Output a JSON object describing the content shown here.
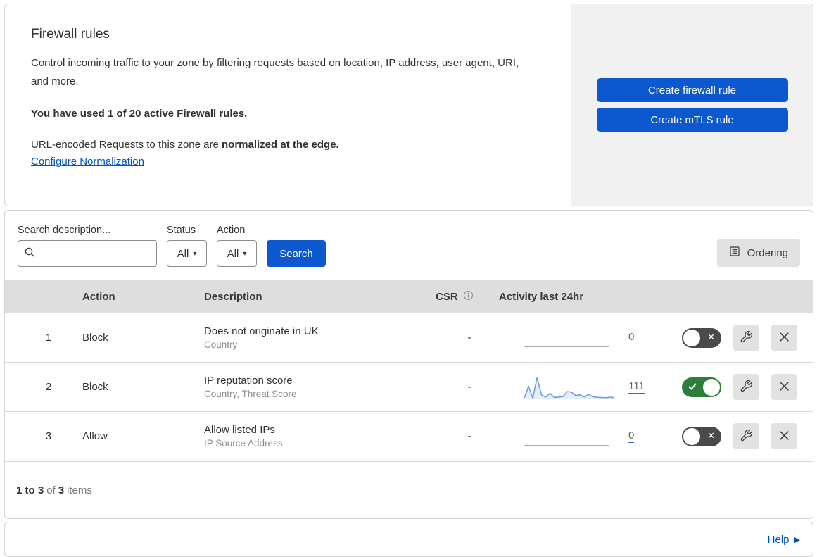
{
  "header": {
    "title": "Firewall rules",
    "description": "Control incoming traffic to your zone by filtering requests based on location, IP address, user agent, URI, and more.",
    "usage_notice": "You have used 1 of 20 active Firewall rules.",
    "normalization_prefix": "URL-encoded Requests to this zone are ",
    "normalization_bold": "normalized at the edge.",
    "normalization_link": "Configure Normalization",
    "create_firewall_button": "Create firewall rule",
    "create_mtls_button": "Create mTLS rule"
  },
  "filters": {
    "search_label": "Search description...",
    "search_value": "",
    "status_label": "Status",
    "status_value": "All",
    "action_label": "Action",
    "action_value": "All",
    "search_button": "Search",
    "ordering_button": "Ordering"
  },
  "table": {
    "columns": {
      "action": "Action",
      "description": "Description",
      "csr": "CSR",
      "activity": "Activity last 24hr"
    },
    "rows": [
      {
        "priority": "1",
        "action": "Block",
        "description": "Does not originate in UK",
        "criteria": "Country",
        "csr": "-",
        "activity_count": "0",
        "enabled": false,
        "sparkline": []
      },
      {
        "priority": "2",
        "action": "Block",
        "description": "IP reputation score",
        "criteria": "Country, Threat Score",
        "csr": "-",
        "activity_count": "111",
        "enabled": true,
        "sparkline": [
          3,
          56,
          2,
          97,
          17,
          7,
          24,
          5,
          7,
          9,
          32,
          30,
          13,
          18,
          7,
          19,
          8,
          6,
          5,
          4,
          6,
          4
        ]
      },
      {
        "priority": "3",
        "action": "Allow",
        "description": "Allow listed IPs",
        "criteria": "IP Source Address",
        "csr": "-",
        "activity_count": "0",
        "enabled": false,
        "sparkline": []
      }
    ],
    "summary": {
      "range": "1 to 3",
      "of_label": "of",
      "total": "3",
      "items_label": "items"
    }
  },
  "footer": {
    "help_label": "Help"
  },
  "icons": {
    "dropdown_caret": "▾",
    "toggle_off_glyph": "✕",
    "help_arrow": "▶"
  },
  "colors": {
    "accent_blue": "#0b58cf",
    "link_blue": "#0051c3",
    "toggle_on_green": "#2e7d38",
    "toggle_off_gray": "#4a4a4a",
    "sparkline_blue": "#6d9add",
    "table_header_bg": "#dedede",
    "panel_gray": "#f1f1f1"
  }
}
